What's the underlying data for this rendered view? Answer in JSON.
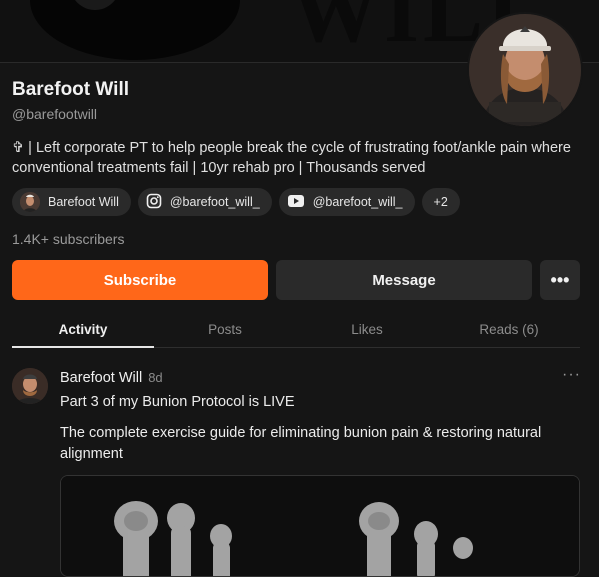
{
  "profile": {
    "name": "Barefoot Will",
    "handle": "@barefootwill",
    "bio": "✞ | Left corporate PT to help people break the cycle of frustrating foot/ankle pain where conventional treatments fail | 10yr rehab pro | Thousands served",
    "subscribers": "1.4K+ subscribers"
  },
  "links": [
    {
      "label": "Barefoot Will",
      "icon": "avatar"
    },
    {
      "label": "@barefoot_will_",
      "icon": "instagram-icon"
    },
    {
      "label": "@barefoot_will_",
      "icon": "youtube-icon"
    },
    {
      "label": "+2"
    }
  ],
  "actions": {
    "subscribe": "Subscribe",
    "message": "Message",
    "more": "•••"
  },
  "tabs": [
    "Activity",
    "Posts",
    "Likes",
    "Reads (6)"
  ],
  "post": {
    "author": "Barefoot Will",
    "age": "8d",
    "menu": "···",
    "title": "Part 3 of my Bunion Protocol is LIVE",
    "body": "The complete exercise guide for eliminating bunion pain & restoring natural alignment"
  },
  "colors": {
    "accent": "#ff6719",
    "background": "#151515"
  }
}
